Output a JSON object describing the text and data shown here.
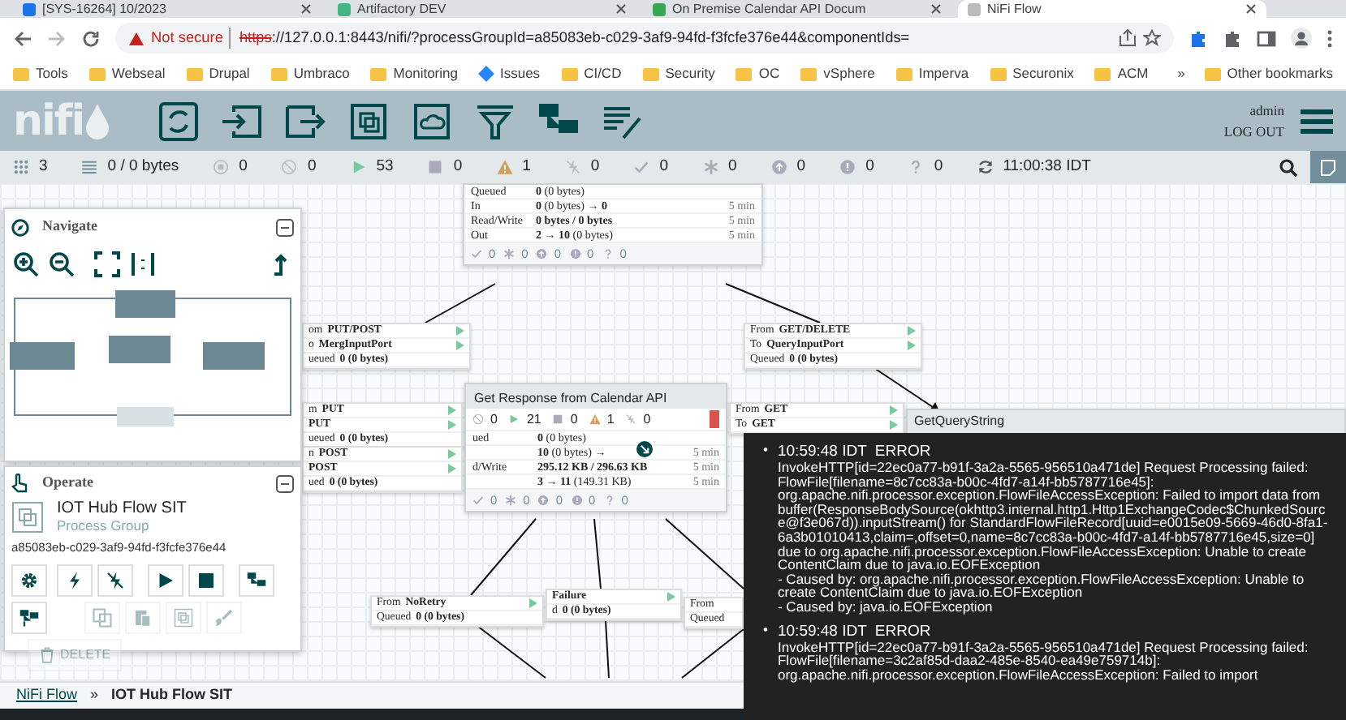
{
  "browser": {
    "tabs": [
      {
        "title": "[SYS-16264] 10/2023",
        "selected": false
      },
      {
        "title": "Artifactory DEV",
        "selected": false
      },
      {
        "title": "On Premise Calendar API Docum",
        "selected": false
      },
      {
        "title": "NiFi Flow",
        "selected": true
      }
    ],
    "security_label": "Not secure",
    "url_scheme": "https",
    "url_rest": "://127.0.0.1:8443/nifi/?processGroupId=a85083eb-c029-3af9-94fd-f3fcfe376e44&componentIds=",
    "bookmarks": [
      {
        "label": "Tools",
        "kind": "folder"
      },
      {
        "label": "Webseal",
        "kind": "folder"
      },
      {
        "label": "Drupal",
        "kind": "folder"
      },
      {
        "label": "Umbraco",
        "kind": "folder"
      },
      {
        "label": "Monitoring",
        "kind": "folder"
      },
      {
        "label": "Issues",
        "kind": "site"
      },
      {
        "label": "CI/CD",
        "kind": "folder"
      },
      {
        "label": "Security",
        "kind": "folder"
      },
      {
        "label": "OC",
        "kind": "folder"
      },
      {
        "label": "vSphere",
        "kind": "folder"
      },
      {
        "label": "Imperva",
        "kind": "folder"
      },
      {
        "label": "Securonix",
        "kind": "folder"
      },
      {
        "label": "ACM",
        "kind": "folder"
      }
    ],
    "bookmarks_more": "»",
    "other_bookmarks": "Other bookmarks"
  },
  "logo_text": "nifi",
  "user": {
    "name": "admin",
    "logout": "LOG OUT"
  },
  "status_bar": [
    {
      "kind": "clusters",
      "value": "3"
    },
    {
      "kind": "queued",
      "value": "0 / 0 bytes"
    },
    {
      "kind": "transmitting",
      "value": "0"
    },
    {
      "kind": "not-transmitting",
      "value": "0"
    },
    {
      "kind": "running",
      "value": "53"
    },
    {
      "kind": "stopped",
      "value": "0"
    },
    {
      "kind": "invalid",
      "value": "1"
    },
    {
      "kind": "disabled",
      "value": "0"
    },
    {
      "kind": "up-to-date",
      "value": "0"
    },
    {
      "kind": "modified",
      "value": "0"
    },
    {
      "kind": "stale",
      "value": "0"
    },
    {
      "kind": "locally-modified-stale",
      "value": "0"
    },
    {
      "kind": "sync-failure",
      "value": "0"
    },
    {
      "kind": "refresh",
      "value": "11:00:38 IDT"
    }
  ],
  "navigate": {
    "title": "Navigate"
  },
  "operate": {
    "title": "Operate",
    "component_name": "IOT Hub Flow SIT",
    "component_type": "Process Group",
    "component_id": "a85083eb-c029-3af9-94fd-f3fcfe376e44",
    "buttons": [
      {
        "kind": "configure",
        "disabled": false
      },
      {
        "kind": "enable",
        "disabled": false
      },
      {
        "kind": "disable",
        "disabled": false
      },
      {
        "kind": "start",
        "disabled": false
      },
      {
        "kind": "stop",
        "disabled": false
      },
      {
        "kind": "create-template",
        "disabled": false
      },
      {
        "kind": "upload-template",
        "disabled": false
      },
      {
        "kind": "copy",
        "disabled": true
      },
      {
        "kind": "paste",
        "disabled": true
      },
      {
        "kind": "group",
        "disabled": true
      },
      {
        "kind": "color",
        "disabled": true
      },
      {
        "kind": "delete",
        "label": "DELETE",
        "disabled": true
      }
    ]
  },
  "canvas": {
    "process_groups": [
      {
        "bulletin": false,
        "stats": [
          {
            "label": "Queued",
            "value": "**0** (0 bytes)"
          },
          {
            "label": "In",
            "value": "**0** (0 bytes) → **0**",
            "time": "5 min"
          },
          {
            "label": "Read/Write",
            "value": "**0 bytes / 0 bytes**",
            "time": "5 min"
          },
          {
            "label": "Out",
            "value": "**2 → 10** (0 bytes)",
            "time": "5 min"
          }
        ],
        "footer": [
          {
            "kind": "up-to-date",
            "value": "0"
          },
          {
            "kind": "modified",
            "value": "0"
          },
          {
            "kind": "stale",
            "value": "0"
          },
          {
            "kind": "locally-modified-stale",
            "value": "0"
          },
          {
            "kind": "sync-failure",
            "value": "0"
          }
        ]
      },
      {
        "title": "Get Response from Calendar API",
        "bulletin": true,
        "counts": [
          {
            "kind": "not-transmitting",
            "value": "0"
          },
          {
            "kind": "running",
            "value": "21"
          },
          {
            "kind": "stopped",
            "value": "0"
          },
          {
            "kind": "invalid",
            "value": "1"
          },
          {
            "kind": "disabled",
            "value": "0"
          }
        ],
        "stats": [
          {
            "label": "ued",
            "value": "**0** (0 bytes)"
          },
          {
            "value": "**10** (0 bytes) →",
            "time": "5 min"
          },
          {
            "label": "d/Write",
            "value": "**295.12 KB / 296.63 KB**",
            "time": "5 min"
          },
          {
            "value": "**3 → 11** (149.31 KB)",
            "time": "5 min"
          }
        ],
        "footer": [
          {
            "kind": "up-to-date",
            "value": "0"
          },
          {
            "kind": "modified",
            "value": "0"
          },
          {
            "kind": "stale",
            "value": "0"
          },
          {
            "kind": "locally-modified-stale",
            "value": "0"
          },
          {
            "kind": "sync-failure",
            "value": "0"
          }
        ]
      }
    ],
    "processors": [
      {
        "name": "GetQueryString"
      }
    ],
    "connections": [
      {
        "rows": [
          {
            "label": "om",
            "value": "PUT/POST",
            "arrow": true
          },
          {
            "label": "o",
            "value": "MergInputPort",
            "arrow": true
          },
          {
            "label": "ueued",
            "value": "0 (0 bytes)"
          }
        ]
      },
      {
        "rows": [
          {
            "label": "From",
            "value": "GET/DELETE",
            "arrow": true
          },
          {
            "label": "To",
            "value": "QueryInputPort",
            "arrow": true
          },
          {
            "label": "Queued",
            "value": "0 (0 bytes)"
          }
        ]
      },
      {
        "rows": [
          {
            "label": "m",
            "value": "PUT",
            "arrow": true
          },
          {
            "value": "PUT",
            "arrow": true
          },
          {
            "label": "ueued",
            "value": "0 (0 bytes)"
          }
        ]
      },
      {
        "rows": [
          {
            "label": "n",
            "value": "POST",
            "arrow": true
          },
          {
            "value": "POST",
            "arrow": true
          },
          {
            "label": "ued",
            "value": "0 (0 bytes)"
          }
        ]
      },
      {
        "rows": [
          {
            "label": "From",
            "value": "GET",
            "arrow": true
          },
          {
            "label": "To",
            "value": "GET",
            "arrow": true
          }
        ]
      },
      {
        "rows": [
          {
            "label": "From",
            "value": "NoRetry",
            "arrow": true
          },
          {
            "label": "Queued",
            "value": "0 (0 bytes)"
          }
        ]
      },
      {
        "rows": [
          {
            "value": "Failure",
            "arrow": true
          },
          {
            "label": "d",
            "value": "0 (0 bytes)"
          }
        ]
      },
      {
        "rows": [
          {
            "label": "From"
          },
          {
            "label": "Queued"
          }
        ]
      }
    ]
  },
  "bulletins": [
    {
      "marker": "•",
      "time": "10:59:48 IDT",
      "level": "ERROR",
      "lines": [
        "InvokeHTTP[id=22ec0a77-b91f-3a2a-5565-956510a471de] Request Processing failed: FlowFile[filename=8c7cc83a-b00c-4fd7-a14f-bb5787716e45]: org.apache.nifi.processor.exception.FlowFileAccessException: Failed to import data from buffer(ResponseBodySource(okhttp3.internal.http1.Http1ExchangeCodec$ChunkedSource@f3e067d)).inputStream() for StandardFlowFileRecord[uuid=e0015e09-5669-46d0-8fa1-6a3b01010413,claim=,offset=0,name=8c7cc83a-b00c-4fd7-a14f-bb5787716e45,size=0] due to org.apache.nifi.processor.exception.FlowFileAccessException: Unable to create ContentClaim due to java.io.EOFException",
        "- Caused by: org.apache.nifi.processor.exception.FlowFileAccessException: Unable to create ContentClaim due to java.io.EOFException",
        "- Caused by: java.io.EOFException"
      ]
    },
    {
      "marker": "•",
      "time": "10:59:48 IDT",
      "level": "ERROR",
      "lines": [
        "InvokeHTTP[id=22ec0a77-b91f-3a2a-5565-956510a471de] Request Processing failed: FlowFile[filename=3c2af85d-daa2-485e-8540-ea49e759714b]: org.apache.nifi.processor.exception.FlowFileAccessException: Failed to import"
      ]
    }
  ],
  "breadcrumbs": [
    {
      "label": "NiFi Flow",
      "selected": false
    },
    {
      "label": "IOT Hub Flow SIT",
      "selected": true
    }
  ],
  "breadcrumb_separator": "»"
}
